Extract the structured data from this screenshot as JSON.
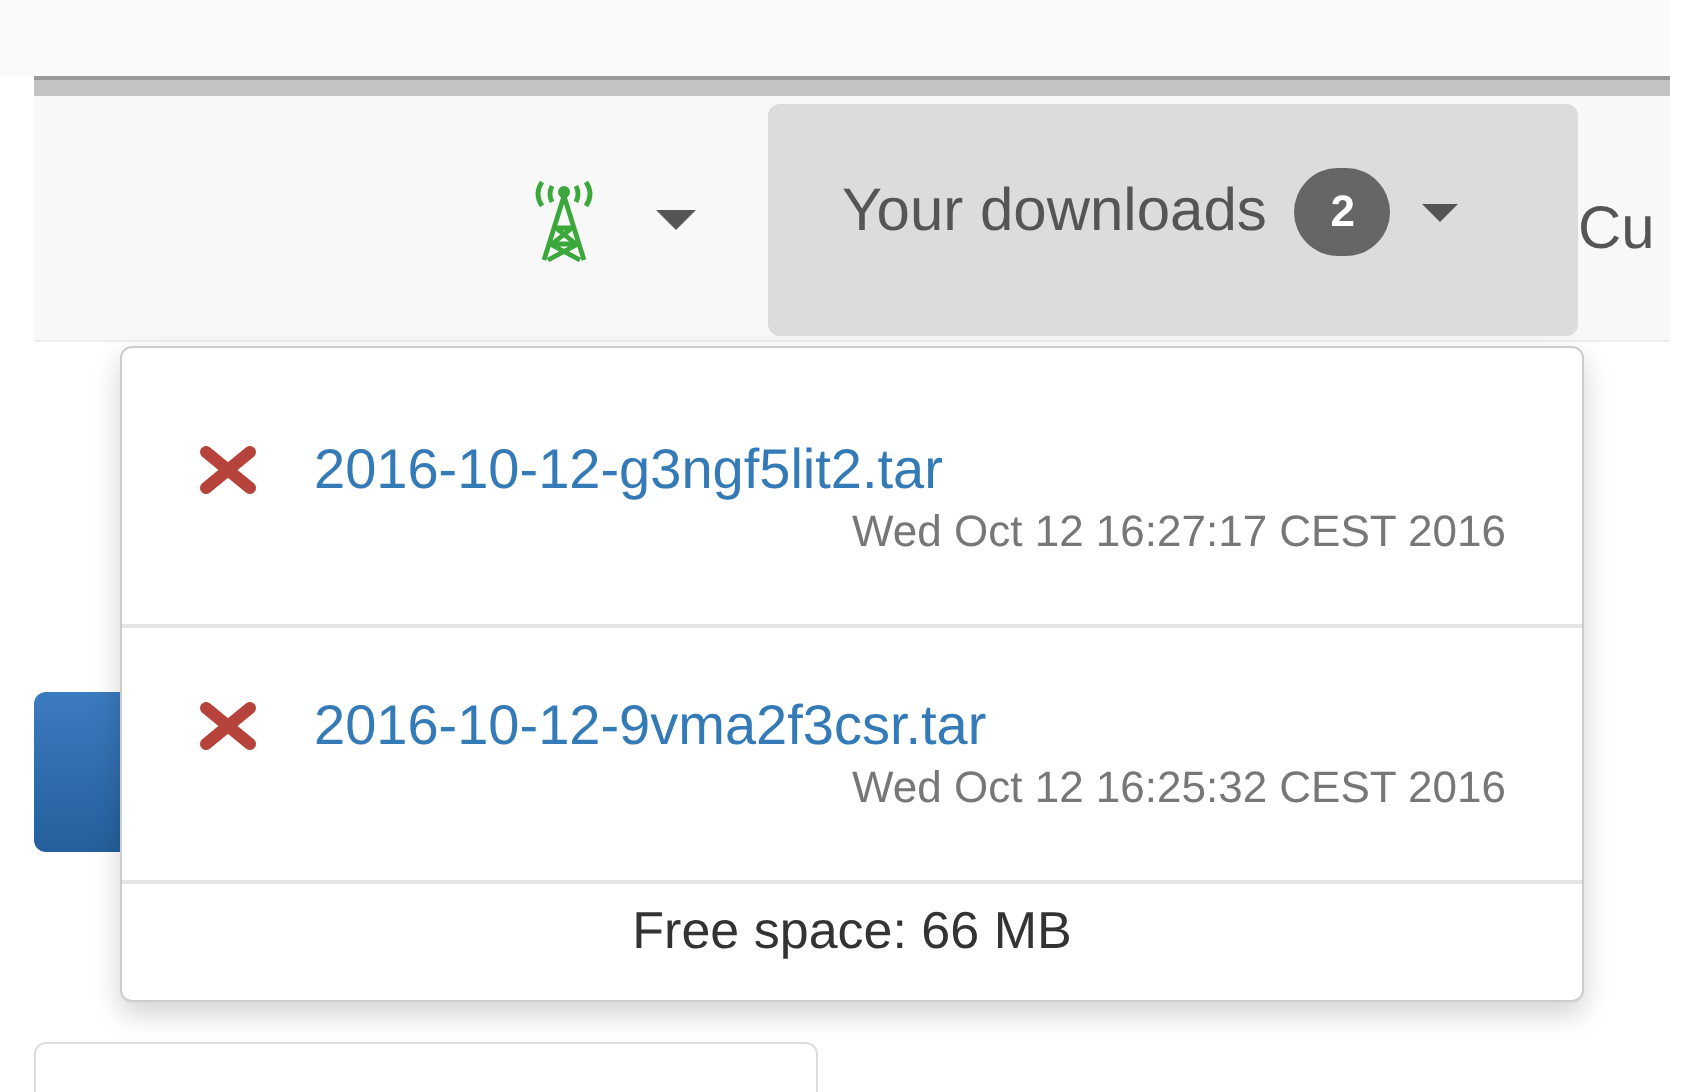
{
  "navbar": {
    "signal_menu": {
      "expanded": false
    },
    "downloads_button": {
      "label": "Your downloads",
      "count": "2",
      "expanded": true
    },
    "next_item": {
      "label": "Cu"
    }
  },
  "downloads_menu": {
    "items": [
      {
        "file": "2016-10-12-g3ngf5lit2.tar",
        "date": "Wed Oct 12 16:27:17 CEST 2016"
      },
      {
        "file": "2016-10-12-9vma2f3csr.tar",
        "date": "Wed Oct 12 16:25:32 CEST 2016"
      }
    ],
    "footer": "Free space: 66 MB"
  }
}
